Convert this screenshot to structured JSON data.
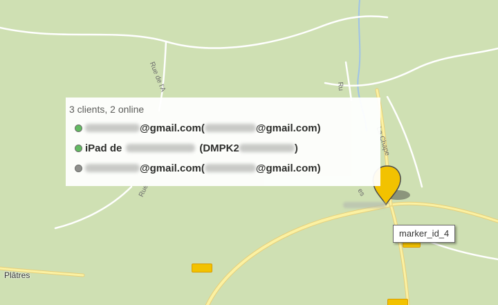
{
  "map": {
    "background_color": "#cfe0b3",
    "road_color": "#fbf1a2",
    "road_outline_color": "#e6cf7a",
    "minor_road_color": "#ffffff",
    "river_color": "#9fc3e7",
    "road_labels": [
      "Rue de l'A",
      "Ru",
      "Rue",
      "La Chape",
      "es"
    ],
    "place_labels": [
      "Plâtres"
    ]
  },
  "info_window": {
    "header": "3 clients, 2 online",
    "clients": [
      {
        "status": "online",
        "status_color": "#5cb85c",
        "name_suffix": "@gmail.com",
        "open_paren": " (",
        "id_suffix": "@gmail.com)"
      },
      {
        "status": "online",
        "status_color": "#5cb85c",
        "name_prefix": "iPad de",
        "id_prefix": "(DMPK2",
        "close_paren": ")"
      },
      {
        "status": "offline",
        "status_color": "#8a8a8a",
        "name_suffix": "@gmail.com",
        "open_paren": " (",
        "id_suffix": "@gmail.com)"
      }
    ]
  },
  "marker": {
    "color": "#f2c200",
    "tooltip": "marker_id_4"
  }
}
